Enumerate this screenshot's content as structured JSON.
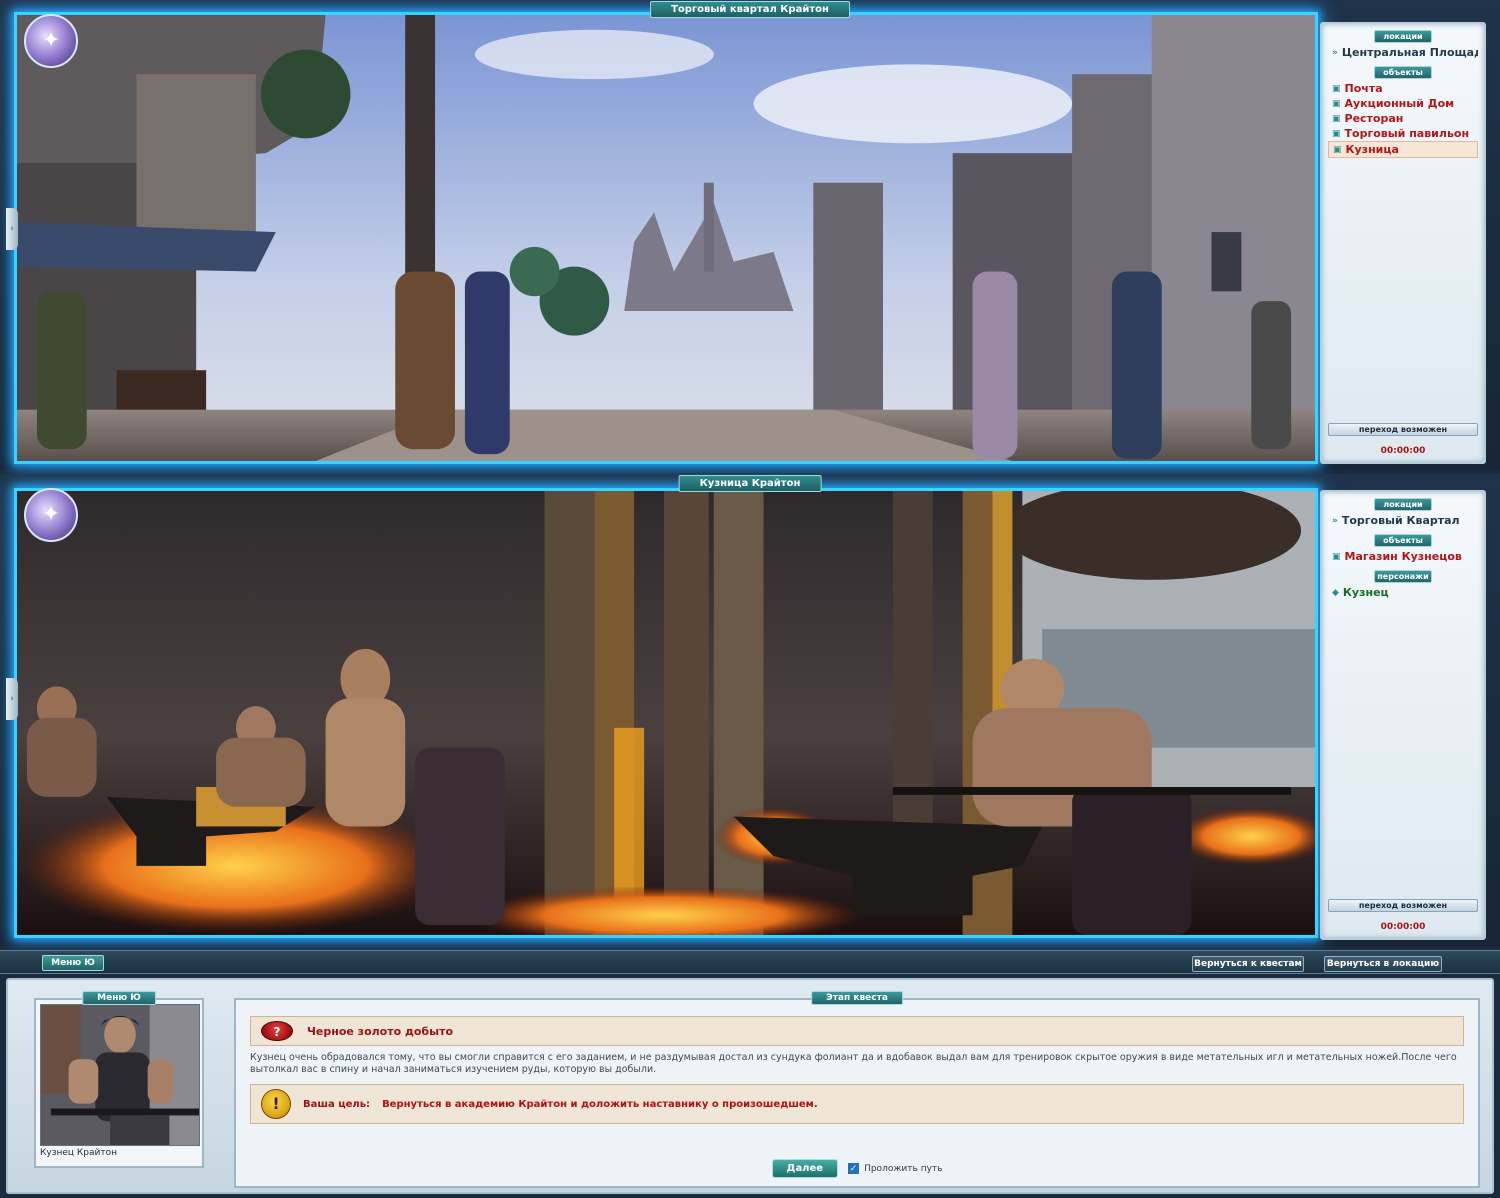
{
  "top_location": {
    "title": "Торговый квартал Крайтон",
    "side_sections": {
      "locations_header": "локации",
      "objects_header": "объекты"
    },
    "locations": [
      "Центральная Площадь"
    ],
    "objects": [
      {
        "label": "Почта",
        "active": false
      },
      {
        "label": "Аукционный Дом",
        "active": false
      },
      {
        "label": "Ресторан",
        "active": false
      },
      {
        "label": "Торговый павильон",
        "active": false
      },
      {
        "label": "Кузница",
        "active": true
      }
    ],
    "status": "переход возможен",
    "timer": "00:00:00"
  },
  "mid_location": {
    "title": "Кузница Крайтон",
    "side_sections": {
      "locations_header": "локации",
      "objects_header": "объекты",
      "npc_header": "персонажи"
    },
    "locations": [
      "Торговый Квартал"
    ],
    "objects": [
      "Магазин Кузнецов"
    ],
    "npcs": [
      "Кузнец"
    ],
    "status": "переход возможен",
    "timer": "00:00:00"
  },
  "dialog_bar": {
    "menu_tab": "Меню Ю",
    "return_quests_button": "Вернуться к квестам",
    "return_location_button": "Вернуться в локацию"
  },
  "portrait": {
    "tab": "Меню Ю",
    "caption": "Кузнец Крайтон"
  },
  "quest": {
    "tab": "Этап квеста",
    "title": "Черное золото добыто",
    "text": "Кузнец очень обрадовался тому, что вы смогли справится с его заданием, и не раздумывая достал из сундука фолиант да и вдобавок выдал вам для тренировок скрытое оружия в виде метательных игл и метательных ножей.После чего вытолкал вас в спину и начал заниматься изучением руды, которую вы добыли.",
    "goal_label": "Ваша цель:",
    "goal_text": "Вернуться в академию Крайтон и доложить наставнику о произошедшем.",
    "next_button": "Далее",
    "path_checkbox_label": "Проложить путь",
    "path_checked": true
  },
  "colors": {
    "frame_glow": "#36d4ff",
    "object_text": "#b01818",
    "npc_text": "#1a6a2a",
    "tab_teal": "#2f8e90"
  }
}
